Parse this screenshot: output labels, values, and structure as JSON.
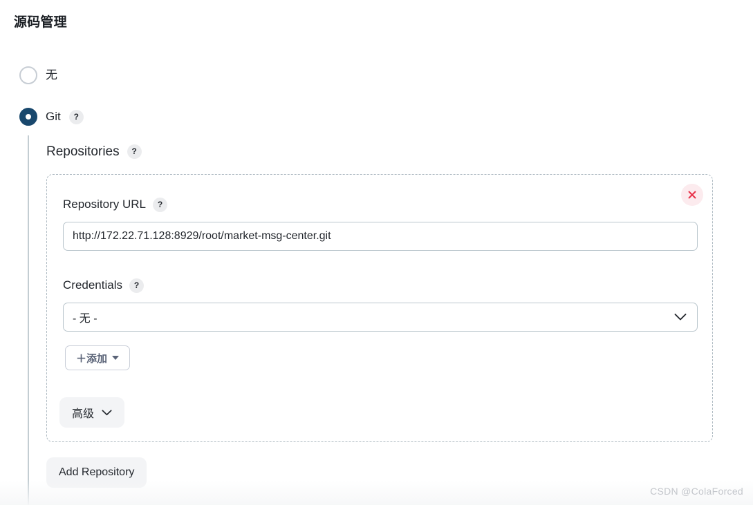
{
  "page": {
    "title": "源码管理"
  },
  "scm_options": [
    {
      "label": "无",
      "selected": false,
      "has_help": false
    },
    {
      "label": "Git",
      "selected": true,
      "has_help": true
    }
  ],
  "repositories_section": {
    "heading": "Repositories",
    "help": "?"
  },
  "repository": {
    "remove_title": "",
    "url_field": {
      "label": "Repository URL",
      "help": "?",
      "value": "http://172.22.71.128:8929/root/market-msg-center.git",
      "placeholder": ""
    },
    "credentials_field": {
      "label": "Credentials",
      "help": "?",
      "selected": "- 无 -",
      "options": [
        "- 无 -"
      ]
    },
    "add_credentials_label": "＋添加",
    "advanced_label": "高级"
  },
  "actions": {
    "add_repository": "Add Repository"
  },
  "watermark": "CSDN @ColaForced",
  "colors": {
    "radio_selected": "#19486d",
    "remove_icon": "#e8334a",
    "remove_bg": "#fcebee",
    "dashed_border": "#aebac2",
    "input_border": "#b9c5cc",
    "button_bg": "#f3f4f6",
    "help_badge_bg": "#ebecee",
    "guide_line": "#c3cdd2",
    "watermark": "#c3c6cb"
  }
}
